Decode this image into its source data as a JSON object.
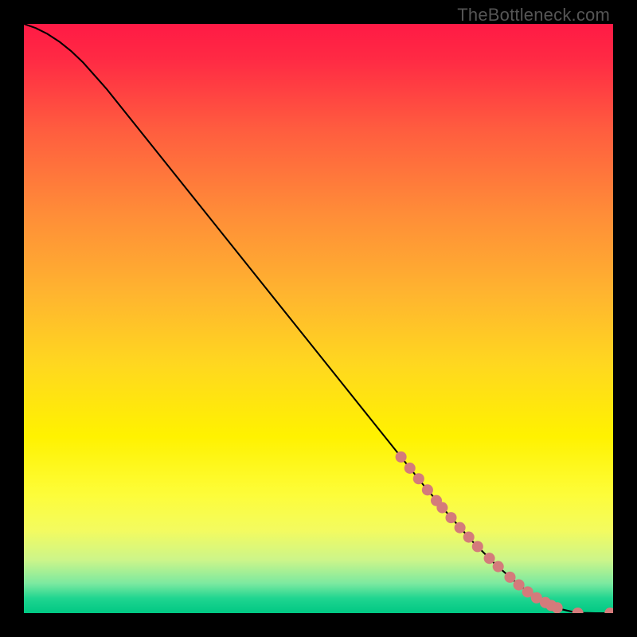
{
  "watermark": "TheBottleneck.com",
  "chart_data": {
    "type": "line",
    "title": "",
    "xlabel": "",
    "ylabel": "",
    "xlim": [
      0,
      100
    ],
    "ylim": [
      0,
      100
    ],
    "grid": false,
    "legend": false,
    "series": [
      {
        "name": "curve",
        "x": [
          0,
          2,
          4,
          6,
          8,
          10,
          14,
          18,
          24,
          30,
          38,
          46,
          54,
          62,
          68,
          72,
          76,
          80,
          84,
          87,
          89,
          91,
          93,
          95,
          97,
          100
        ],
        "y": [
          100,
          99.3,
          98.3,
          97.0,
          95.4,
          93.5,
          89.0,
          84.0,
          76.5,
          69.0,
          59.0,
          49.0,
          39.0,
          29.0,
          21.5,
          16.8,
          12.3,
          8.3,
          4.8,
          2.6,
          1.4,
          0.7,
          0.25,
          0.05,
          0,
          0
        ]
      }
    ],
    "points": {
      "name": "highlighted-range",
      "x": [
        64,
        65.5,
        67,
        68.5,
        70,
        71,
        72.5,
        74,
        75.5,
        77,
        79,
        80.5,
        82.5,
        84,
        85.5,
        87,
        88.5,
        89.5,
        90.5,
        94,
        99.5
      ],
      "y": [
        26.5,
        24.6,
        22.8,
        20.9,
        19.1,
        17.9,
        16.2,
        14.5,
        12.9,
        11.3,
        9.3,
        7.9,
        6.1,
        4.8,
        3.6,
        2.6,
        1.8,
        1.3,
        0.9,
        0,
        0
      ]
    },
    "gradient_stops": [
      {
        "offset": 0.0,
        "color": "#ff1a45"
      },
      {
        "offset": 0.06,
        "color": "#ff2a44"
      },
      {
        "offset": 0.18,
        "color": "#ff5d3f"
      },
      {
        "offset": 0.32,
        "color": "#ff8c38"
      },
      {
        "offset": 0.46,
        "color": "#ffb52f"
      },
      {
        "offset": 0.58,
        "color": "#ffd81f"
      },
      {
        "offset": 0.7,
        "color": "#fff200"
      },
      {
        "offset": 0.8,
        "color": "#fdfd3a"
      },
      {
        "offset": 0.86,
        "color": "#f3fb60"
      },
      {
        "offset": 0.91,
        "color": "#ccf58a"
      },
      {
        "offset": 0.95,
        "color": "#7be9a0"
      },
      {
        "offset": 0.975,
        "color": "#1fd590"
      },
      {
        "offset": 1.0,
        "color": "#00c883"
      }
    ]
  }
}
